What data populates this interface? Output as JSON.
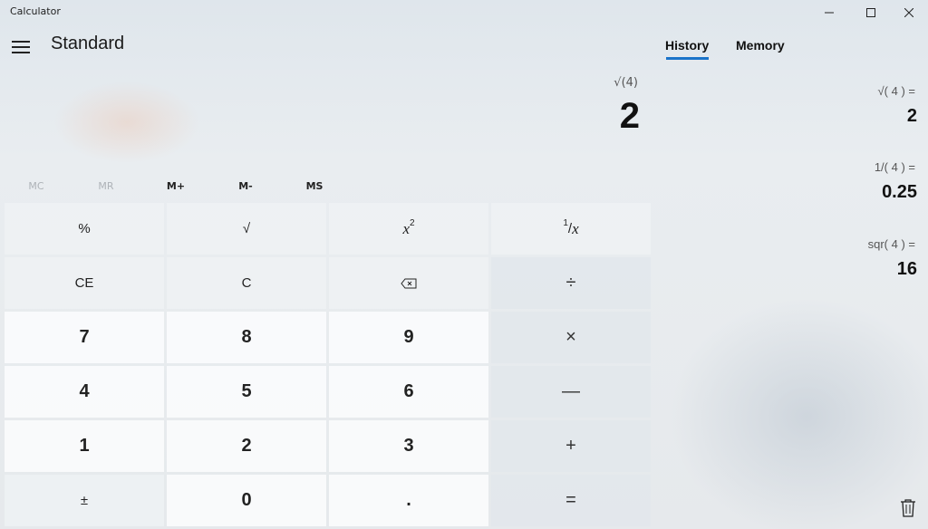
{
  "window": {
    "title": "Calculator",
    "controls": {
      "minimize": "—",
      "maximize": "☐",
      "close": "✕"
    }
  },
  "header": {
    "mode": "Standard"
  },
  "display": {
    "expression": "√(4)",
    "value": "2"
  },
  "memory_buttons": [
    {
      "label": "MC",
      "enabled": false
    },
    {
      "label": "MR",
      "enabled": false
    },
    {
      "label": "M+",
      "enabled": true
    },
    {
      "label": "M-",
      "enabled": true
    },
    {
      "label": "MS",
      "enabled": true
    }
  ],
  "keypad": {
    "percent": "%",
    "sqrt": "√",
    "square_base": "x",
    "square_exp": "2",
    "reciprocal_num": "1",
    "reciprocal_den": "x",
    "ce": "CE",
    "c": "C",
    "backspace": "⌫",
    "divide": "÷",
    "n7": "7",
    "n8": "8",
    "n9": "9",
    "multiply": "×",
    "n4": "4",
    "n5": "5",
    "n6": "6",
    "minus": "—",
    "n1": "1",
    "n2": "2",
    "n3": "3",
    "plus": "+",
    "negate": "±",
    "n0": "0",
    "decimal": ".",
    "equals": "="
  },
  "side_panel": {
    "tabs": [
      "History",
      "Memory"
    ],
    "active_tab": "History",
    "history": [
      {
        "expression": "√( 4 ) =",
        "result": "2"
      },
      {
        "expression": "1/( 4 ) =",
        "result": "0.25"
      },
      {
        "expression": "sqr( 4 ) =",
        "result": "16"
      }
    ],
    "clear_icon": "trash-icon"
  },
  "colors": {
    "accent": "#1a73c9"
  }
}
